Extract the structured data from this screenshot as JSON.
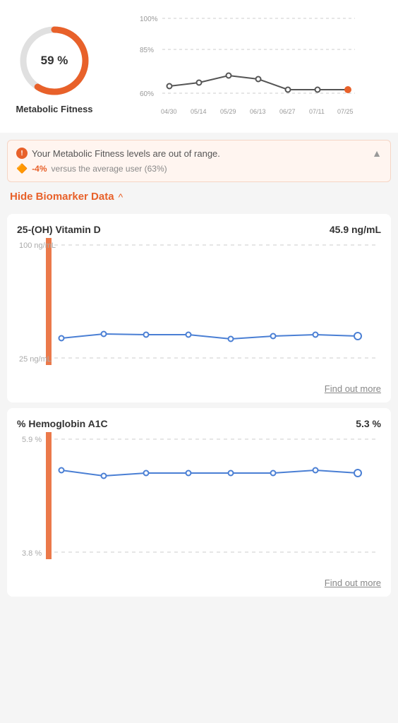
{
  "metabolic": {
    "score": "59 %",
    "label": "Metabolic Fitness",
    "score_number": 59,
    "color_fill": "#e8612a",
    "color_track": "#e0e0e0"
  },
  "trend_chart": {
    "x_labels": [
      "04/30",
      "05/14",
      "05/29",
      "06/13",
      "06/27",
      "07/11",
      "07/25"
    ],
    "y_labels": [
      "100%",
      "85%",
      "60%"
    ],
    "points": [
      62,
      63,
      65,
      64,
      61,
      61,
      61
    ]
  },
  "alert": {
    "main_text": "Your Metabolic Fitness levels are out of range.",
    "diff_text": "-4%",
    "diff_detail": " versus the average user (63%)"
  },
  "hide_biomarker": {
    "label": "Hide Biomarker Data",
    "chevron": "^"
  },
  "vitaminD": {
    "title": "25-(OH) Vitamin D",
    "value": "45.9 ng/mL",
    "y_high_label": "100 ng/mL",
    "y_low_label": "25 ng/mL",
    "find_out_more": "Find out more",
    "points": [
      38,
      41,
      40,
      40,
      36,
      39,
      40,
      39
    ]
  },
  "hemoglobin": {
    "title": "% Hemoglobin A1C",
    "value": "5.3 %",
    "y_high_label": "5.9 %",
    "y_low_label": "3.8 %",
    "find_out_more": "Find out more",
    "points": [
      5.4,
      5.3,
      5.35,
      5.35,
      5.35,
      5.35,
      5.4,
      5.35
    ]
  }
}
